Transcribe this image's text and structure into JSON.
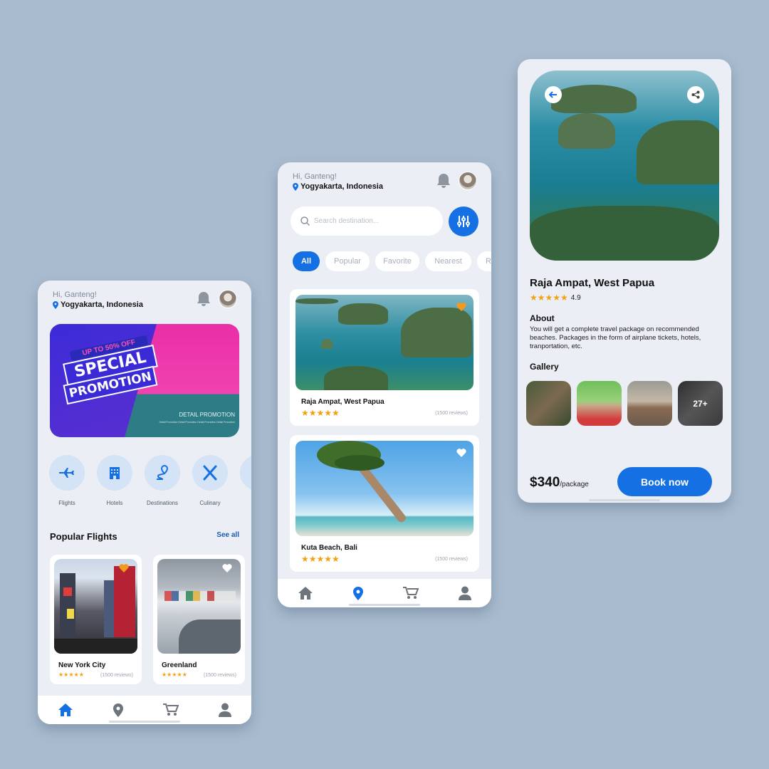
{
  "common": {
    "greeting": "Hi, Ganteng!",
    "location": "Yogyakarta, Indonesia"
  },
  "home": {
    "promo": {
      "badge": "UP TO 50% OFF",
      "line1": "SPECIAL",
      "line2": "PROMOTION",
      "detail": "DETAIL PROMOTION",
      "fine_print": "Detail Promotion Detail Promotion Detail Promotion Detail Promotion"
    },
    "categories": [
      {
        "label": "Flights",
        "icon": "plane-icon"
      },
      {
        "label": "Hotels",
        "icon": "building-icon"
      },
      {
        "label": "Destinations",
        "icon": "route-icon"
      },
      {
        "label": "Culinary",
        "icon": "utensils-icon"
      },
      {
        "label": "",
        "icon": "calendar-icon"
      }
    ],
    "section_title": "Popular Flights",
    "see_all": "See all",
    "cards": [
      {
        "name": "New York City",
        "stars": "★★★★★",
        "reviews": "(1500 reviews)"
      },
      {
        "name": "Greenland",
        "stars": "★★★★★",
        "reviews": "(1500 reviews)"
      }
    ]
  },
  "explore": {
    "search_placeholder": "Search destination...",
    "chips": [
      "All",
      "Popular",
      "Favorite",
      "Nearest",
      "R"
    ],
    "cards": [
      {
        "name": "Raja Ampat, West Papua",
        "stars": "★★★★★",
        "reviews": "(1500 reviews)"
      },
      {
        "name": "Kuta Beach, Bali",
        "stars": "★★★★★",
        "reviews": "(1500 reviews)"
      }
    ]
  },
  "detail": {
    "title": "Raja Ampat, West Papua",
    "stars": "★★★★★",
    "rating": "4.9",
    "about_heading": "About",
    "about_text": "You will get a complete travel package on recommended beaches. Packages in the form of airplane tickets, hotels, tranportation, etc.",
    "gallery_heading": "Gallery",
    "gallery_more": "27+",
    "price": "$340",
    "price_unit": "/package",
    "book_label": "Book now"
  },
  "colors": {
    "primary": "#1570e3",
    "background": "#a9bccf",
    "screen": "#ebeff5",
    "star": "#f5a00e",
    "heart_active": "#f39a1c"
  }
}
